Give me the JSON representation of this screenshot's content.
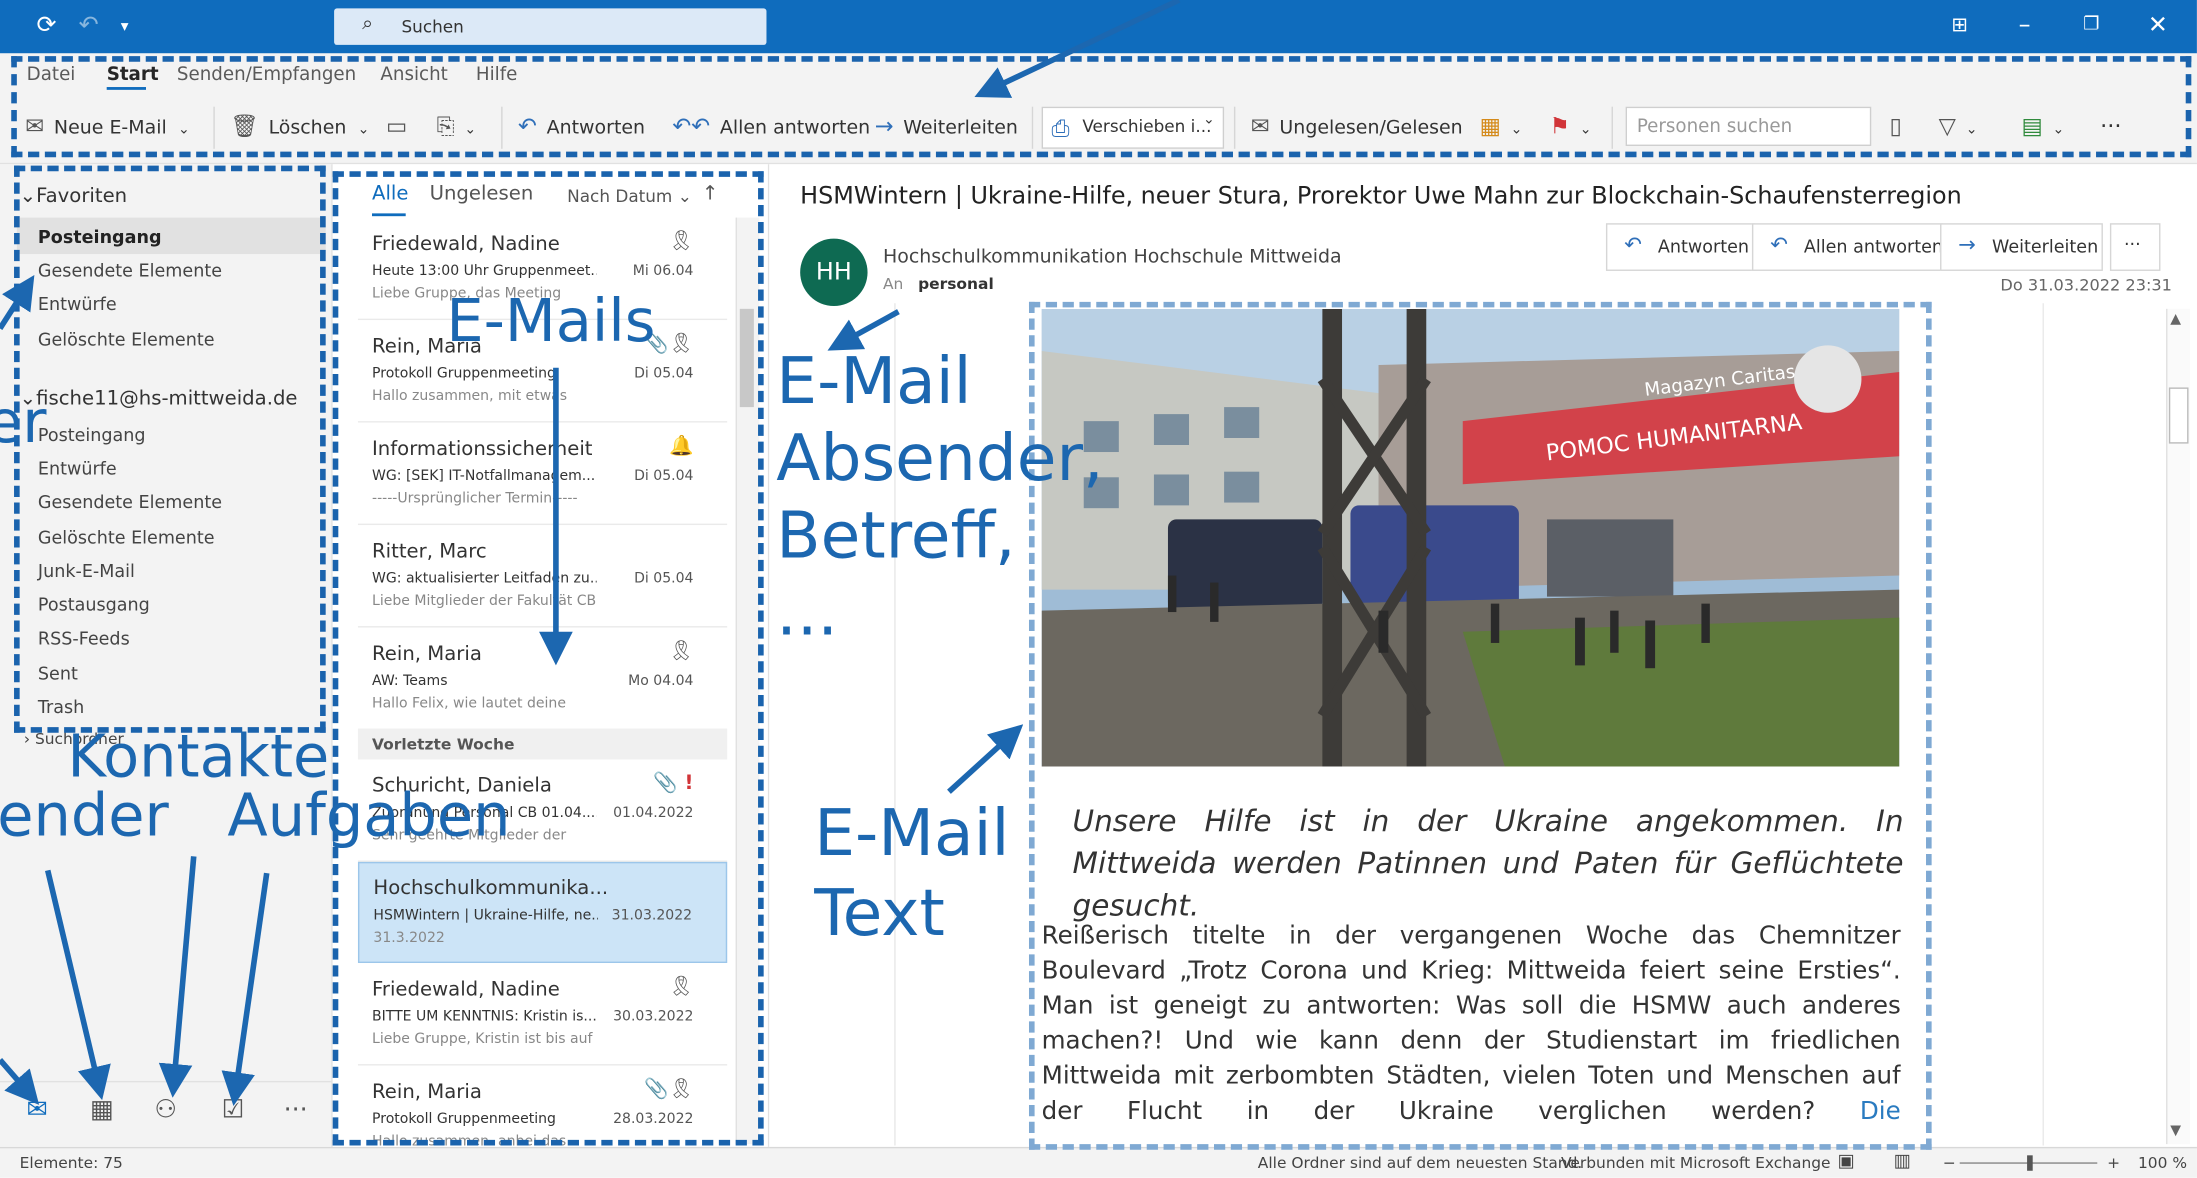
{
  "titlebar": {
    "search_placeholder": "Suchen"
  },
  "menu": [
    "Datei",
    "Start",
    "Senden/Empfangen",
    "Ansicht",
    "Hilfe"
  ],
  "toolbar": {
    "new_mail": "Neue E-Mail",
    "delete": "Löschen",
    "reply": "Antworten",
    "reply_all": "Allen antworten",
    "forward": "Weiterleiten",
    "move": "Verschieben i...",
    "unread_read": "Ungelesen/Gelesen",
    "people_search_placeholder": "Personen suchen",
    "more": "···"
  },
  "folders": {
    "favorites_head": "Favoriten",
    "favorites": [
      "Posteingang",
      "Gesendete Elemente",
      "Entwürfe",
      "Gelöschte Elemente"
    ],
    "account_head": "fische11@hs-mittweida.de",
    "account": [
      "Posteingang",
      "Entwürfe",
      "Gesendete Elemente",
      "Gelöschte Elemente",
      "Junk-E-Mail",
      "Postausgang",
      "RSS-Feeds",
      "Sent",
      "Trash"
    ],
    "search_folders": "Suchordner"
  },
  "list": {
    "tab_all": "Alle",
    "tab_unread": "Ungelesen",
    "sort": "Nach Datum",
    "group_last_week": "Vorletzte Woche",
    "messages": [
      {
        "from": "Friedewald, Nadine",
        "subject": "Heute 13:00 Uhr Gruppenmeet...",
        "preview": "Liebe Gruppe,  das Meeting",
        "date": "Mi 06.04"
      },
      {
        "from": "Rein, Maria",
        "subject": "Protokoll Gruppenmeeting",
        "preview": "Hallo zusammen,   mit etwas",
        "date": "Di 05.04"
      },
      {
        "from": "Informationssicherheit",
        "subject": "WG: [SEK] IT-Notfallmanagem...",
        "preview": "-----Ursprünglicher Termin-----",
        "date": "Di 05.04"
      },
      {
        "from": "Ritter, Marc",
        "subject": "WG: aktualisierter Leitfaden zu...",
        "preview": "Liebe Mitglieder der Fakultät CB,",
        "date": "Di 05.04"
      },
      {
        "from": "Rein, Maria",
        "subject": "AW: Teams",
        "preview": "Hallo Felix,   wie lautet deine",
        "date": "Mo 04.04"
      },
      {
        "from": "Schuricht, Daniela",
        "subject": "Zuordnung Personal CB 01.04....",
        "preview": "Sehr geehrte Mitglieder der",
        "date": "01.04.2022"
      },
      {
        "from": "Hochschulkommunika...",
        "subject": "HSMWintern | Ukraine-Hilfe, ne...",
        "preview": "31.3.2022",
        "date": "31.03.2022"
      },
      {
        "from": "Friedewald, Nadine",
        "subject": "BITTE UM KENNTNIS: Kristin is...",
        "preview": "Liebe Gruppe,   Kristin ist bis auf",
        "date": "30.03.2022"
      },
      {
        "from": "Rein, Maria",
        "subject": "Protokoll Gruppenmeeting",
        "preview": "Hallo zusammen,   anbei das",
        "date": "28.03.2022"
      }
    ]
  },
  "reading": {
    "subject": "HSMWintern | Ukraine-Hilfe, neuer Stura, Prorektor Uwe Mahn zur Blockchain-Schaufensterregion",
    "avatar": "HH",
    "sender": "Hochschulkommunikation Hochschule Mittweida",
    "to_label": "An",
    "to": "personal",
    "date": "Do 31.03.2022 23:31",
    "btn_reply": "Antworten",
    "btn_reply_all": "Allen antworten",
    "btn_forward": "Weiterleiten",
    "btn_more": "···",
    "photo_banner_left": "POMOC HUMANITARNA",
    "photo_banner_right": "Magazyn Caritas",
    "lead": "Unsere Hilfe ist in der Ukraine angekommen. In Mittweida werden Patinnen und Paten für Geflüchtete gesucht.",
    "body": "Reißerisch titelte in der vergangenen Woche das Chemnitzer Boulevard „Trotz Corona und Krieg: Mittweida feiert seine Ersties“. Man ist geneigt zu antworten: Was soll die HSMW auch anderes machen?! Und wie kann denn der Studienstart im friedlichen Mittweida mit zerbombten Städten, vielen Toten und Menschen auf der Flucht in der Ukraine verglichen werden?",
    "body_link": "Die Immatrikulationsfeier hat ihre kleinen, aber deutlichen Botschaften zum"
  },
  "status": {
    "items": "Elemente: 75",
    "folders_state": "Alle Ordner sind auf dem neuesten Stand.",
    "connection": "Verbunden mit Microsoft Exchange",
    "zoom": "100 %"
  },
  "annotations": {
    "emails": "E-Mails",
    "sender_line1": "E-Mail",
    "sender_line2": "Absender,",
    "sender_line3": "Betreff,",
    "sender_line4": "...",
    "text_line1": "E-Mail",
    "text_line2": "Text",
    "contacts": "Kontakte",
    "calendar": "ender",
    "tasks": "Aufgaben",
    "folders_partial": "er"
  },
  "colors": {
    "accent": "#0f6cbd",
    "annotation": "#1c67b0",
    "avatar": "#0e6a52"
  }
}
